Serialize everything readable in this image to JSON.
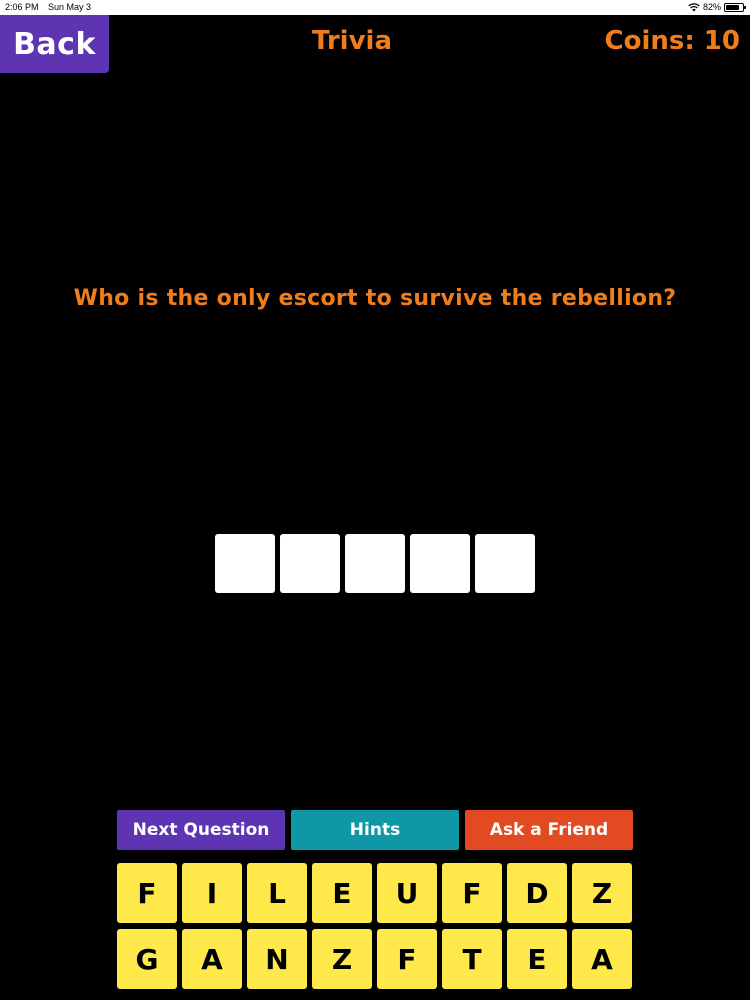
{
  "status_bar": {
    "time": "2:06 PM",
    "date": "Sun May 3",
    "battery": "82%",
    "battery_level": 0.82,
    "icons": [
      "wifi-icon",
      "battery-icon"
    ]
  },
  "header": {
    "back_label": "Back",
    "title": "Trivia",
    "coins": "Coins: 10"
  },
  "question": {
    "text": "Who is the only escort to survive the rebellion?",
    "answer_length": 5
  },
  "actions": {
    "next_question": "Next Question",
    "hints": "Hints",
    "ask_friend": "Ask a Friend"
  },
  "keyboard": {
    "rows": [
      [
        "F",
        "I",
        "L",
        "E",
        "U",
        "F",
        "D",
        "Z"
      ],
      [
        "G",
        "A",
        "N",
        "Z",
        "F",
        "T",
        "E",
        "A"
      ]
    ]
  },
  "colors": {
    "background": "#000000",
    "accent_orange": "#f07d1c",
    "back_purple": "#5d35b2",
    "hints_teal": "#0f97a6",
    "friend_red": "#e24a22",
    "key_yellow": "#ffe94a",
    "slot_white": "#ffffff"
  }
}
